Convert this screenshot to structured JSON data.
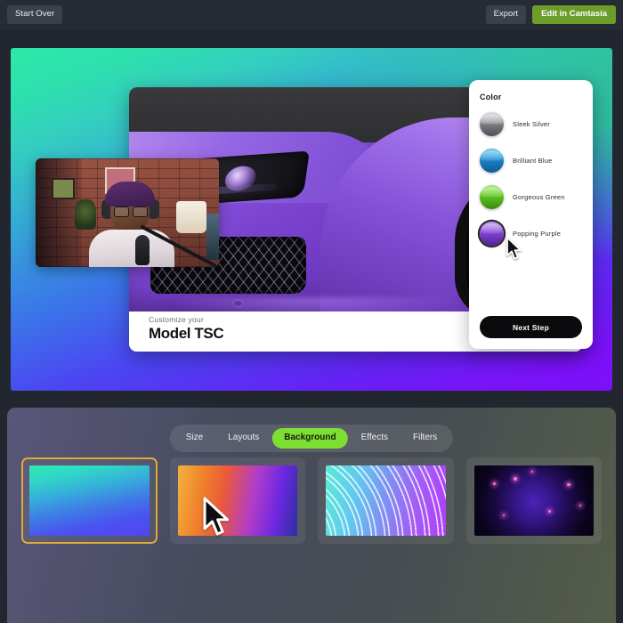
{
  "topbar": {
    "start_over_label": "Start Over",
    "export_label": "Export",
    "camtasia_label": "Edit in Camtasia",
    "camtasia_color": "#6c9d2a"
  },
  "canvas": {
    "background_gradient": [
      "#2ce9a8",
      "#35a8d6",
      "#4b45f2",
      "#7c0ff9"
    ],
    "product_card": {
      "kicker": "Customize your",
      "title": "Model TSC",
      "image_alt": "purple-sports-car"
    },
    "webcam_overlay": {
      "alt": "presenter-at-microphone-brick-wall"
    },
    "color_panel": {
      "heading": "Color",
      "swatches": [
        {
          "label": "Sleek Silver",
          "color": "#8b8b90",
          "highlight": "#d6d6da",
          "selected": false
        },
        {
          "label": "Brilliant Blue",
          "color": "#1b84c4",
          "highlight": "#63c2ec",
          "selected": false
        },
        {
          "label": "Gorgeous Green",
          "color": "#5cc11e",
          "highlight": "#a6e86a",
          "selected": false
        },
        {
          "label": "Popping Purple",
          "color": "#7a3fc9",
          "highlight": "#b58cec",
          "selected": true
        }
      ],
      "next_step_label": "Next Step"
    }
  },
  "bottom": {
    "tabs": [
      {
        "label": "Size",
        "active": false
      },
      {
        "label": "Layouts",
        "active": false
      },
      {
        "label": "Background",
        "active": true
      },
      {
        "label": "Effects",
        "active": false
      },
      {
        "label": "Filters",
        "active": false
      }
    ],
    "active_tab_color": "#7ede33",
    "selected_border_color": "#ddab32",
    "thumbnails": [
      {
        "name": "green-blue-gradient",
        "selected": true
      },
      {
        "name": "orange-purple-gradient",
        "selected": false
      },
      {
        "name": "cyan-purple-dot-arcs",
        "selected": false
      },
      {
        "name": "dark-purple-nebula",
        "selected": false
      }
    ]
  },
  "cursors": [
    {
      "name": "pointer-on-popping-purple"
    },
    {
      "name": "pointer-on-background-thumbnail"
    }
  ]
}
